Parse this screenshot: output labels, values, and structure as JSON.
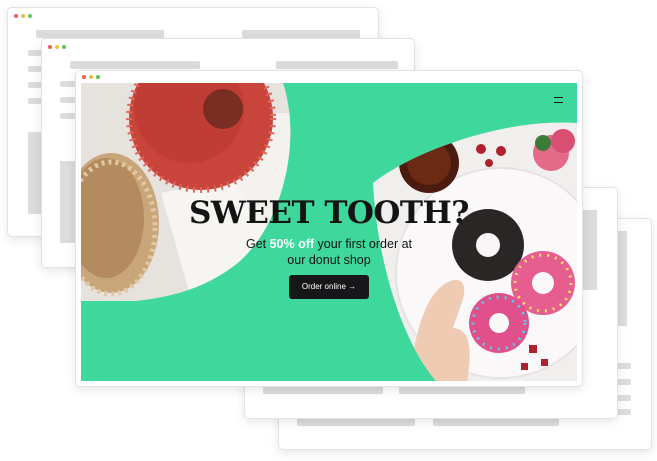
{
  "hero": {
    "headline": "SWEET TOOTH?",
    "sub_pre": "Get ",
    "sub_highlight": "50% off",
    "sub_line1_rest": " your first order at",
    "sub_line2": "our donut shop",
    "cta_label": "Order online →",
    "menu_icon": "hamburger-menu-icon"
  },
  "colors": {
    "hero_background": "#3ed89d",
    "cta_background": "#17171a",
    "headline": "#141414",
    "highlight": "#ffffff",
    "window_dot_red": "#f15c55",
    "window_dot_yellow": "#f6be3c",
    "window_dot_green": "#5ac54e"
  }
}
